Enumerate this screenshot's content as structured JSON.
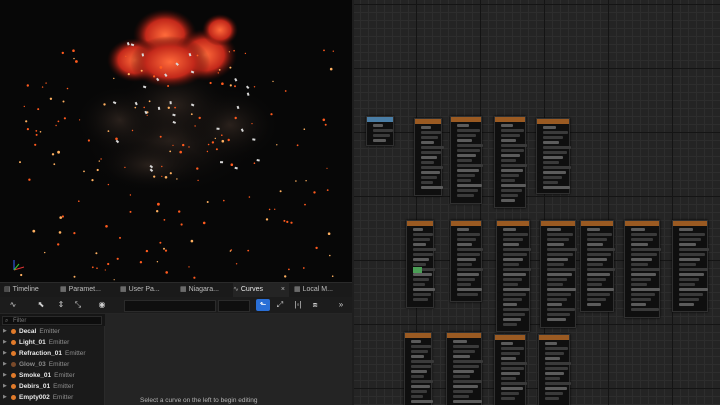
{
  "tabs": [
    {
      "label": "Timeline",
      "icon": "timeline-icon"
    },
    {
      "label": "Paramet...",
      "icon": "parameters-icon"
    },
    {
      "label": "User Pa...",
      "icon": "user-parameters-icon"
    },
    {
      "label": "Niagara...",
      "icon": "niagara-icon"
    },
    {
      "label": "Curves",
      "icon": "curves-icon",
      "active": true,
      "close": "×"
    },
    {
      "label": "Local M...",
      "icon": "local-modules-icon"
    }
  ],
  "toolbar": {
    "curve_mode_icon": "∿",
    "select_icon": "⬑",
    "more_icon": "»"
  },
  "filter": {
    "placeholder": "Filter"
  },
  "emitters": [
    {
      "name": "Decal",
      "type": "Emitter",
      "enabled": true
    },
    {
      "name": "Light_01",
      "type": "Emitter",
      "enabled": true
    },
    {
      "name": "Refraction_01",
      "type": "Emitter",
      "enabled": true
    },
    {
      "name": "Glow_03",
      "type": "Emitter",
      "enabled": false
    },
    {
      "name": "Smoke_01",
      "type": "Emitter",
      "enabled": true
    },
    {
      "name": "Debirs_01",
      "type": "Emitter",
      "enabled": true
    },
    {
      "name": "Empty002",
      "type": "Emitter",
      "enabled": true
    }
  ],
  "curve_editor": {
    "message": "Select a curve on the left to begin editing"
  },
  "colors": {
    "accent": "#2a6fd6",
    "node_header": "#9a5a22",
    "emitter_dot": "#e07a2a"
  }
}
